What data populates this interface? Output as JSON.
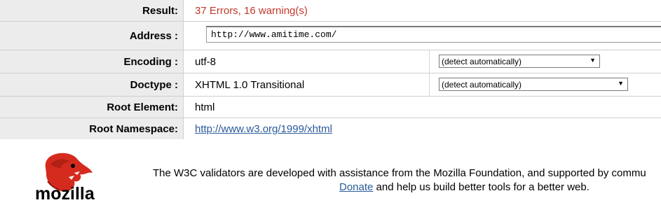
{
  "rows": {
    "result": {
      "label": "Result:",
      "value": "37 Errors, 16 warning(s)"
    },
    "address": {
      "label": "Address :",
      "value": "http://www.amitime.com/"
    },
    "encoding": {
      "label": "Encoding :",
      "value": "utf-8",
      "select": "(detect automatically)"
    },
    "doctype": {
      "label": "Doctype :",
      "value": "XHTML 1.0 Transitional",
      "select": "(detect automatically)"
    },
    "root_element": {
      "label": "Root Element:",
      "value": "html"
    },
    "root_namespace": {
      "label": "Root Namespace:",
      "value": "http://www.w3.org/1999/xhtml"
    }
  },
  "footer": {
    "logo_text": "mozilla",
    "line1": "The W3C validators are developed with assistance from the Mozilla Foundation, and supported by commu",
    "donate": "Donate",
    "line2_rest": " and help us build better tools for a better web."
  },
  "colors": {
    "error": "#c0392b",
    "link": "#2a5a9a",
    "header_bg": "#ececec",
    "logo_red": "#d52b1e"
  }
}
